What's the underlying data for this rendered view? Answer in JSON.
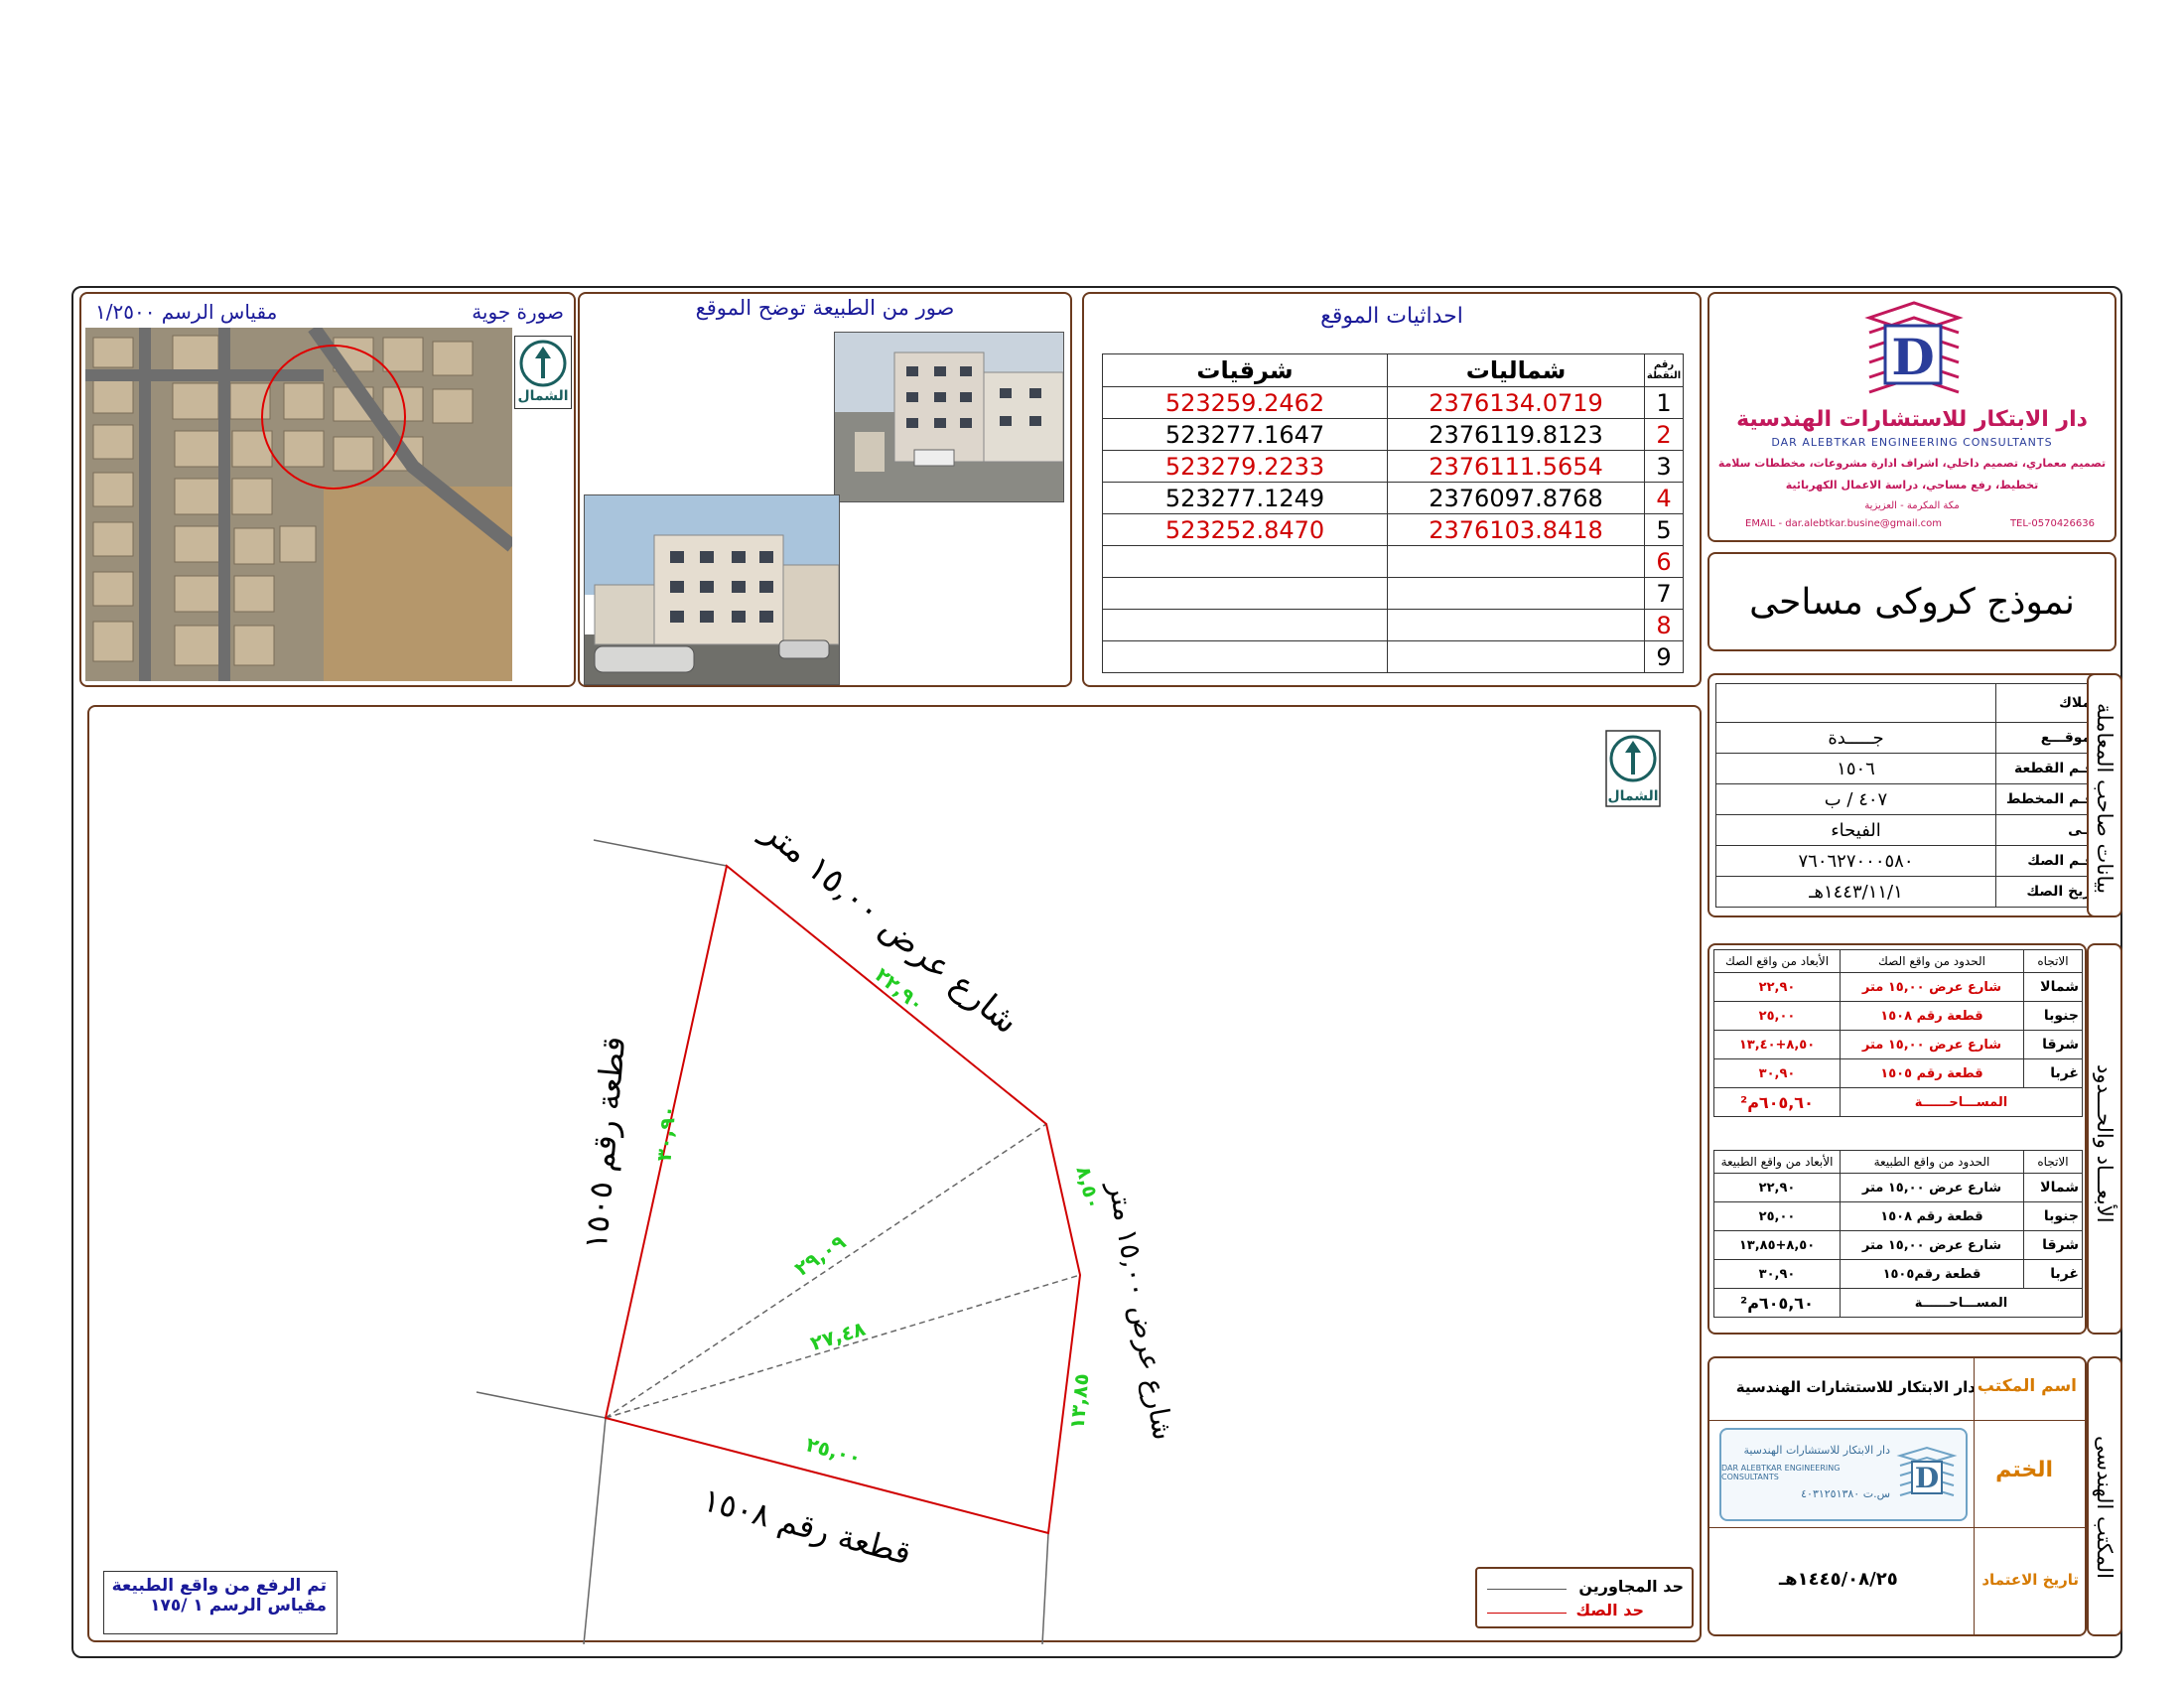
{
  "aerial": {
    "title": "صورة جوية",
    "scale": "مقياس الرسم ١/٢٥٠٠",
    "north_label": "الشمال"
  },
  "photos": {
    "title": "صور من الطبيعة توضح الموقع"
  },
  "coordinates": {
    "title": "احداثيات الموقع",
    "headers": {
      "point": "رقم النقطة",
      "north": "شماليات",
      "east": "شرقيات"
    },
    "rows": [
      {
        "n": "1",
        "north": "2376134.0719",
        "east": "523259.2462"
      },
      {
        "n": "2",
        "north": "2376119.8123",
        "east": "523277.1647"
      },
      {
        "n": "3",
        "north": "2376111.5654",
        "east": "523279.2233"
      },
      {
        "n": "4",
        "north": "2376097.8768",
        "east": "523277.1249"
      },
      {
        "n": "5",
        "north": "2376103.8418",
        "east": "523252.8470"
      },
      {
        "n": "6",
        "north": "",
        "east": ""
      },
      {
        "n": "7",
        "north": "",
        "east": ""
      },
      {
        "n": "8",
        "north": "",
        "east": ""
      },
      {
        "n": "9",
        "north": "",
        "east": ""
      }
    ]
  },
  "office": {
    "name_ar": "دار الابتكار للاستشارات الهندسية",
    "name_en": "DAR ALEBTKAR ENGINEERING CONSULTANTS",
    "services_1": "تصميم معماري، تصميم داخلي، اشراف ادارة مشروعات، مخططات سلامة",
    "services_2": "تخطيط، رفع مساحي، دراسة الاعمال الكهربائية",
    "address": "مكة المكرمة - العزيزية",
    "email": "EMAIL - dar.alebtkar.busine@gmail.com",
    "tel": "TEL-0570426636",
    "logo_letter": "D"
  },
  "form_title": "نموذج كروكى مساحى",
  "owner": {
    "section_label": "بيانات صاحب المعاملة",
    "fields": [
      {
        "label": "الملاك",
        "value": ""
      },
      {
        "label": "الموقـــع",
        "value": "جـــــدة"
      },
      {
        "label": "رقـم القطعة",
        "value": "١٥٠٦"
      },
      {
        "label": "رقـم المخطط",
        "value": "٤٠٧ / ب"
      },
      {
        "label": "حــى",
        "value": "الفيحاء"
      },
      {
        "label": "رقـم الصك",
        "value": "٧٦٠٦٢٧٠٠٠٥٨٠"
      },
      {
        "label": "تاريخ الصك",
        "value": "١٤٤٣/١١/١هـ"
      }
    ]
  },
  "deed_bounds": {
    "section_label": "الأبعـــاد والحـــدود",
    "headers": {
      "dir": "الاتجاه",
      "bound": "الحدود من واقع الصك",
      "dim": "الأبعاد من واقع الصك"
    },
    "rows": [
      {
        "dir": "شمالا",
        "bound": "شارع عرض ١٥,٠٠ متر",
        "dim": "٢٢,٩٠"
      },
      {
        "dir": "جنوبا",
        "bound": "قطعة رقم ١٥٠٨",
        "dim": "٢٥,٠٠"
      },
      {
        "dir": "شرقا",
        "bound": "شارع عرض ١٥,٠٠ متر",
        "dim": "٨,٥٠+١٣,٤٠"
      },
      {
        "dir": "غربا",
        "bound": "قطعة رقم ١٥٠٥",
        "dim": "٣٠,٩٠"
      }
    ],
    "area_label": "المســـاحــــــة",
    "area_value": "٦٠٥,٦٠م²"
  },
  "site_bounds": {
    "headers": {
      "dir": "الاتجاه",
      "bound": "الحدود من واقع الطبيعة",
      "dim": "الأبعاد من واقع الطبيعة"
    },
    "rows": [
      {
        "dir": "شمالا",
        "bound": "شارع عرض ١٥,٠٠ متر",
        "dim": "٢٢,٩٠"
      },
      {
        "dir": "جنوبا",
        "bound": "قطعة رقم ١٥٠٨",
        "dim": "٢٥,٠٠"
      },
      {
        "dir": "شرقا",
        "bound": "شارع عرض ١٥,٠٠ متر",
        "dim": "٨,٥٠+١٣,٨٥"
      },
      {
        "dir": "غربا",
        "bound": "قطعة رقم١٥٠٥",
        "dim": "٣٠,٩٠"
      }
    ],
    "area_label": "المســـاحــــــة",
    "area_value": "٦٠٥,٦٠م²"
  },
  "engineering_office": {
    "section_label": "المكتب الهندسى",
    "name_label": "اسم المكتب",
    "name_value": "دار الابتكار للاستشارات الهندسية",
    "stamp_label": "الختم",
    "stamp_text_ar": "دار الابتكار للاستشارات الهندسية",
    "stamp_text_en": "DAR ALEBTKAR ENGINEERING CONSULTANTS",
    "stamp_number": "س.ت ٤٠٣١٢٥١٣٨٠",
    "date_label": "تاريخ الاعتماد",
    "date_value": "١٤٤٥/٠٨/٢٥هـ"
  },
  "drawing": {
    "north_label": "الشمال",
    "street_north": "شارع عرض ١٥,٠٠ متر",
    "street_east": "شارع عرض ١٥,٠٠ متر",
    "plot_west": "قطعة رقم ١٥٠٥",
    "plot_south": "قطعة رقم ١٥٠٨",
    "dim_north": "٢٢,٩٠",
    "dim_west": "٣٠,٩٠",
    "dim_east_top": "٨,٥٠",
    "dim_east_bottom": "١٣,٨٥",
    "dim_south": "٢٥,٠٠",
    "diag_1": "٢٩,٠٩",
    "diag_2": "٢٧,٤٨"
  },
  "survey_note": {
    "line1": "تم الرفع من واقع الطبيعة",
    "line2": "مقياس الرسم   ١ /١٧٥"
  },
  "legend": {
    "neighbors": "حد المجاورين",
    "deed": "حد الصك"
  }
}
